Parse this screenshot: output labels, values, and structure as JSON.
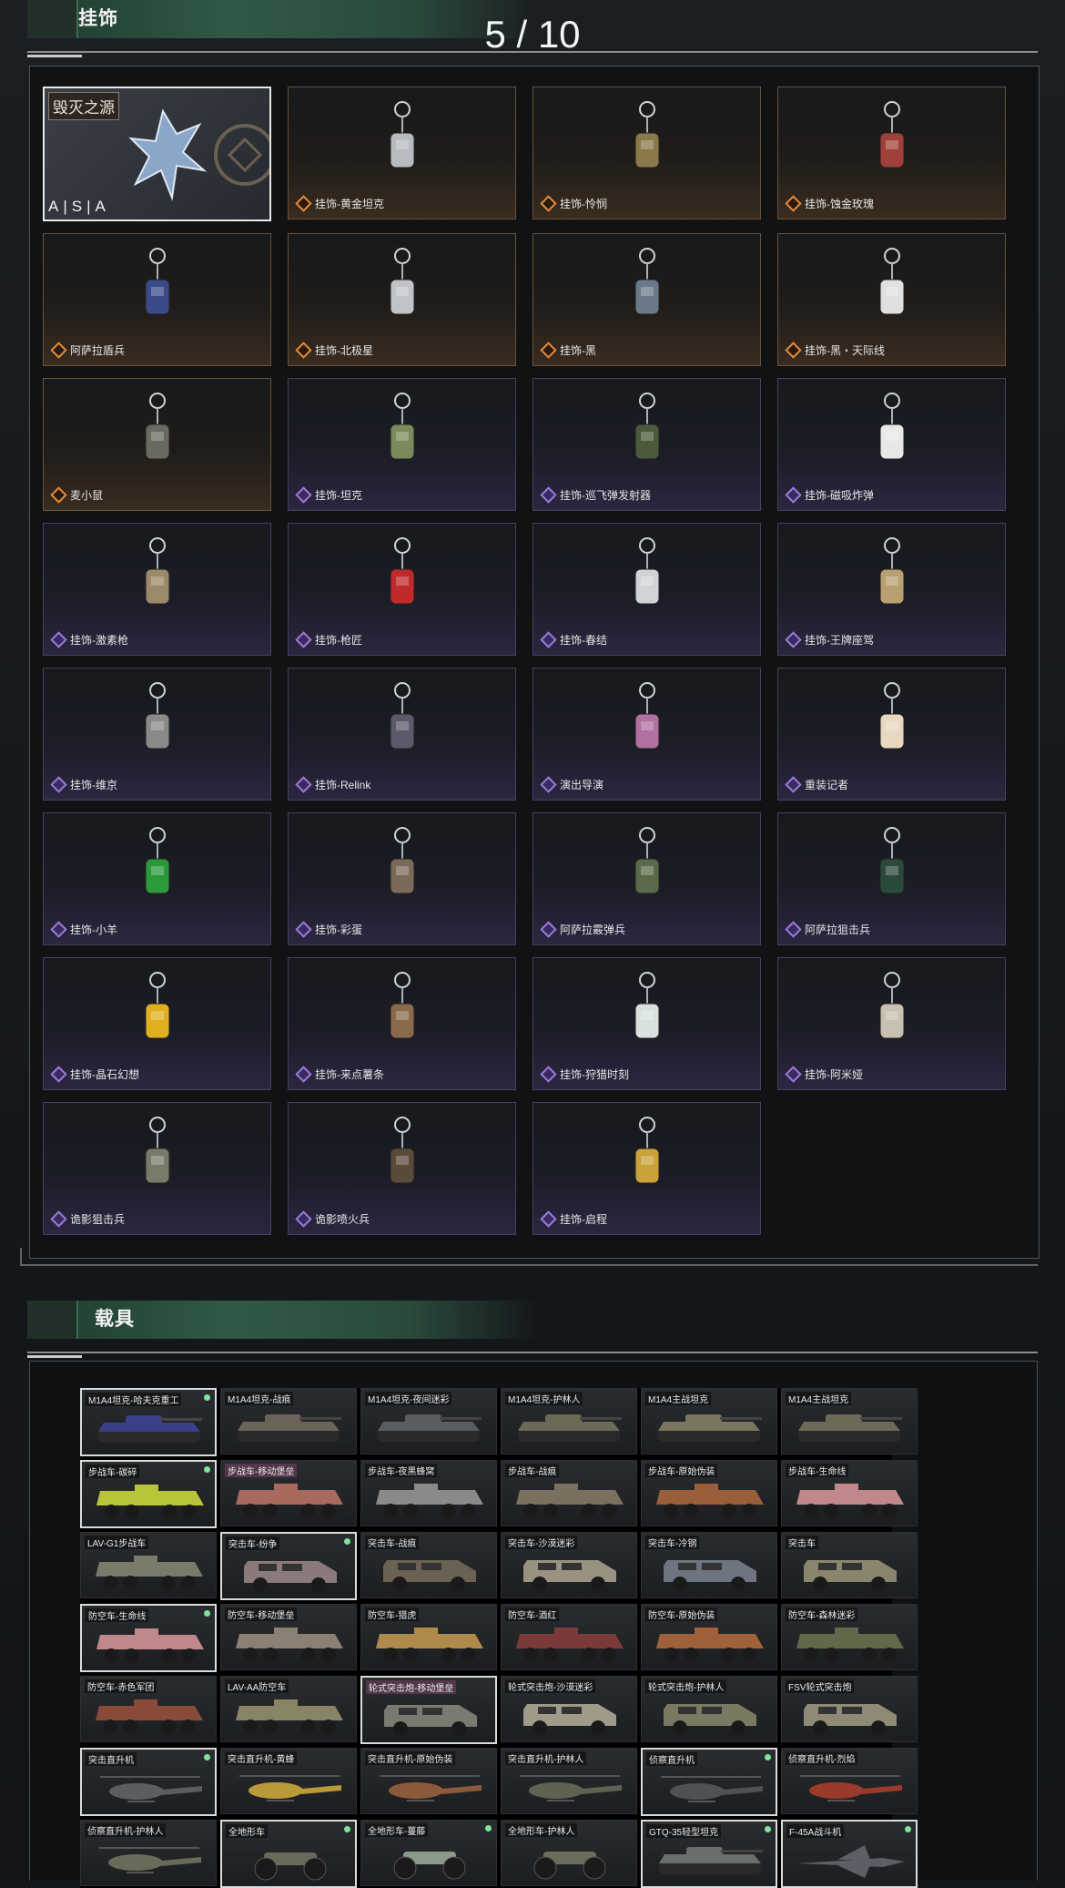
{
  "header": {
    "title": "挂饰",
    "page": "5 / 10"
  },
  "charms": [
    {
      "label": "毁灭之源",
      "sub": "A|S|A",
      "rarity": "feature"
    },
    {
      "label": "挂饰-黄金坦克",
      "rarity": "gold"
    },
    {
      "label": "挂饰-怜悯",
      "rarity": "gold"
    },
    {
      "label": "挂饰-蚀金玫瑰",
      "rarity": "gold"
    },
    {
      "label": "阿萨拉盾兵",
      "rarity": "gold"
    },
    {
      "label": "挂饰-北极星",
      "rarity": "gold"
    },
    {
      "label": "挂饰-黑",
      "rarity": "gold"
    },
    {
      "label": "挂饰-黑・天际线",
      "rarity": "gold"
    },
    {
      "label": "麦小鼠",
      "rarity": "gold"
    },
    {
      "label": "挂饰-坦克",
      "rarity": "purple"
    },
    {
      "label": "挂饰-巡飞弹发射器",
      "rarity": "purple"
    },
    {
      "label": "挂饰-磁吸炸弹",
      "rarity": "purple"
    },
    {
      "label": "挂饰-激素枪",
      "rarity": "purple"
    },
    {
      "label": "挂饰-枪匠",
      "rarity": "purple"
    },
    {
      "label": "挂饰-春结",
      "rarity": "purple"
    },
    {
      "label": "挂饰-王牌座驾",
      "rarity": "purple"
    },
    {
      "label": "挂饰-维京",
      "rarity": "purple"
    },
    {
      "label": "挂饰-Relink",
      "rarity": "purple"
    },
    {
      "label": "演出导演",
      "rarity": "purple"
    },
    {
      "label": "重装记者",
      "rarity": "purple"
    },
    {
      "label": "挂饰-小羊",
      "rarity": "purple"
    },
    {
      "label": "挂饰-彩蛋",
      "rarity": "purple"
    },
    {
      "label": "阿萨拉霰弹兵",
      "rarity": "purple"
    },
    {
      "label": "阿萨拉狙击兵",
      "rarity": "purple"
    },
    {
      "label": "挂饰-晶石幻想",
      "rarity": "purple"
    },
    {
      "label": "挂饰-来点薯条",
      "rarity": "purple"
    },
    {
      "label": "挂饰-狩猎时刻",
      "rarity": "purple"
    },
    {
      "label": "挂饰-阿米娅",
      "rarity": "purple"
    },
    {
      "label": "诡影狙击兵",
      "rarity": "purple"
    },
    {
      "label": "诡影喷火兵",
      "rarity": "purple"
    },
    {
      "label": "挂饰-启程",
      "rarity": "purple"
    }
  ],
  "vehicles_header": {
    "title": "载具"
  },
  "vehicles": [
    {
      "label": "M1A4坦克-哈夫克重工",
      "kind": "tank",
      "sel": true,
      "dot": true,
      "color": "#3a3f8a"
    },
    {
      "label": "M1A4坦克-战痕",
      "kind": "tank",
      "color": "#6c6358"
    },
    {
      "label": "M1A4坦克-夜间迷彩",
      "kind": "tank",
      "color": "#5a5e62"
    },
    {
      "label": "M1A4坦克-护林人",
      "kind": "tank",
      "color": "#6b6a55"
    },
    {
      "label": "M1A4主战坦克",
      "kind": "tank",
      "color": "#7a7660"
    },
    {
      "label": "M1A4主战坦克",
      "kind": "tank",
      "color": "#6e6a58"
    },
    {
      "label": "步战车-碳碎",
      "kind": "apc",
      "sel": true,
      "dot": true,
      "color": "#b8c43a"
    },
    {
      "label": "步战车-移动堡垒",
      "kind": "apc",
      "pink": true,
      "color": "#a86a5e"
    },
    {
      "label": "步战车-夜黑蜂窝",
      "kind": "apc",
      "color": "#8a8a8a"
    },
    {
      "label": "步战车-战痕",
      "kind": "apc",
      "color": "#7a7060"
    },
    {
      "label": "步战车-原始伪装",
      "kind": "apc",
      "color": "#9a5e3a"
    },
    {
      "label": "步战车-生命线",
      "kind": "apc",
      "color": "#c0888a"
    },
    {
      "label": "LAV-G1步战车",
      "kind": "apc",
      "color": "#7a7a6a"
    },
    {
      "label": "突击车-纷争",
      "kind": "truck",
      "sel": true,
      "dot": true,
      "color": "#8a7a7a"
    },
    {
      "label": "突击车-战痕",
      "kind": "truck",
      "color": "#6a6252"
    },
    {
      "label": "突击车-沙漠迷彩",
      "kind": "truck",
      "color": "#9a9280"
    },
    {
      "label": "突击车-冷钢",
      "kind": "truck",
      "color": "#6e7480"
    },
    {
      "label": "突击车",
      "kind": "truck",
      "color": "#8a866e"
    },
    {
      "label": "防空车-生命线",
      "kind": "apc",
      "sel": true,
      "dot": true,
      "color": "#c0888a"
    },
    {
      "label": "防空车-移动堡垒",
      "kind": "apc",
      "color": "#8a8074"
    },
    {
      "label": "防空车-猎虎",
      "kind": "apc",
      "color": "#b08a4a"
    },
    {
      "label": "防空车-酒红",
      "kind": "apc",
      "color": "#7a3a3a"
    },
    {
      "label": "防空车-原始伪装",
      "kind": "apc",
      "color": "#a0603a"
    },
    {
      "label": "防空车-森林迷彩",
      "kind": "apc",
      "color": "#5e6a4a"
    },
    {
      "label": "防空车-赤色军团",
      "kind": "apc",
      "color": "#8a4a3a"
    },
    {
      "label": "LAV-AA防空车",
      "kind": "apc",
      "color": "#8a8466"
    },
    {
      "label": "轮式突击炮-移动堡垒",
      "kind": "truck",
      "sel": true,
      "pink": true,
      "color": "#7a7a70"
    },
    {
      "label": "轮式突击炮-沙漠迷彩",
      "kind": "truck",
      "color": "#a09a88"
    },
    {
      "label": "轮式突击炮-护林人",
      "kind": "truck",
      "color": "#7a7a62"
    },
    {
      "label": "FSV轮式突击炮",
      "kind": "truck",
      "color": "#8e8a76"
    },
    {
      "label": "突击直升机",
      "kind": "heli",
      "sel": true,
      "dot": true,
      "color": "#5a5e62"
    },
    {
      "label": "突击直升机-黄蜂",
      "kind": "heli",
      "color": "#b89a3a"
    },
    {
      "label": "突击直升机-原始伪装",
      "kind": "heli",
      "color": "#8a5a3a"
    },
    {
      "label": "突击直升机-护林人",
      "kind": "heli",
      "color": "#5e6250"
    },
    {
      "label": "侦察直升机",
      "kind": "heli",
      "sel": true,
      "dot": true,
      "color": "#4e5256"
    },
    {
      "label": "侦察直升机-烈焰",
      "kind": "heli",
      "color": "#9a3a2a"
    },
    {
      "label": "侦察直升机-护林人",
      "kind": "heli",
      "color": "#6a6a58"
    },
    {
      "label": "全地形车",
      "kind": "atv",
      "sel": true,
      "dot": true,
      "color": "#6a6a5a"
    },
    {
      "label": "全地形车-蔓藤",
      "kind": "atv",
      "dot": true,
      "color": "#8a9a8a"
    },
    {
      "label": "全地形车-护林人",
      "kind": "atv",
      "color": "#6a6e5a"
    },
    {
      "label": "GTQ-35轻型坦克",
      "kind": "tank",
      "sel": true,
      "dot": true,
      "color": "#6a6e6a"
    },
    {
      "label": "F-45A战斗机",
      "kind": "jet",
      "sel": true,
      "dot": true,
      "color": "#5a6066"
    }
  ]
}
